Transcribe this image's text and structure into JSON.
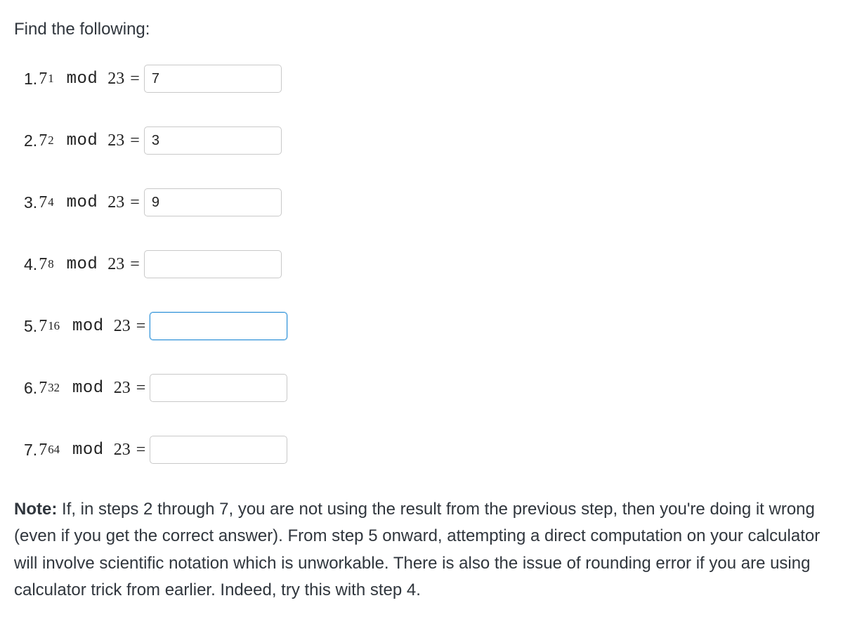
{
  "heading": "Find the following:",
  "problems": [
    {
      "index": "1.",
      "base": "7",
      "exp": "1",
      "mod_label": "mod",
      "modulus": "23",
      "eq": "=",
      "value": "7",
      "focused": false,
      "placeholder": ""
    },
    {
      "index": "2.",
      "base": "7",
      "exp": "2",
      "mod_label": "mod",
      "modulus": "23",
      "eq": "=",
      "value": "3",
      "focused": false,
      "placeholder": ""
    },
    {
      "index": "3.",
      "base": "7",
      "exp": "4",
      "mod_label": "mod",
      "modulus": "23",
      "eq": "=",
      "value": "9",
      "focused": false,
      "placeholder": ""
    },
    {
      "index": "4.",
      "base": "7",
      "exp": "8",
      "mod_label": "mod",
      "modulus": "23",
      "eq": "=",
      "value": "",
      "focused": false,
      "placeholder": ""
    },
    {
      "index": "5.",
      "base": "7",
      "exp": "16",
      "mod_label": "mod",
      "modulus": "23",
      "eq": "=",
      "value": "",
      "focused": true,
      "placeholder": ""
    },
    {
      "index": "6.",
      "base": "7",
      "exp": "32",
      "mod_label": "mod",
      "modulus": "23",
      "eq": "=",
      "value": "",
      "focused": false,
      "placeholder": ""
    },
    {
      "index": "7.",
      "base": "7",
      "exp": "64",
      "mod_label": "mod",
      "modulus": "23",
      "eq": "=",
      "value": "",
      "focused": false,
      "placeholder": ""
    }
  ],
  "note": {
    "bold": "Note:",
    "text": " If, in steps 2 through 7, you are not using the result from the previous step, then you're doing it wrong (even if you get the correct answer). From step 5 onward, attempting a direct computation on your calculator will involve scientific notation which is unworkable. There is also the issue of rounding error if you are using calculator trick from earlier. Indeed, try this with step 4."
  }
}
